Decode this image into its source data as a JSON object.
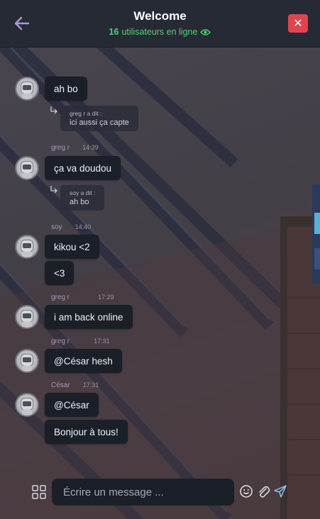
{
  "header": {
    "title": "Welcome",
    "online_count": "16",
    "online_label": "utilisateurs en ligne",
    "close_label": "✕"
  },
  "messages": [
    {
      "type": "bubble",
      "text": "ah bo"
    },
    {
      "type": "reply",
      "quoted_author": "greg r a dit :",
      "quoted_text": "ici aussi ça capte"
    },
    {
      "type": "meta",
      "author": "greg r",
      "time": "14:39"
    },
    {
      "type": "bubble",
      "text": "ça va doudou"
    },
    {
      "type": "reply",
      "quoted_author": "soy a dit :",
      "quoted_text": "ah bo"
    },
    {
      "type": "meta",
      "author": "soy",
      "time": "14:40"
    },
    {
      "type": "bubble",
      "text": "kikou <2"
    },
    {
      "type": "bubble",
      "text": "<3"
    },
    {
      "type": "meta",
      "author": "greg r",
      "time": "17:29"
    },
    {
      "type": "bubble",
      "text": "i am back online"
    },
    {
      "type": "meta",
      "author": "greg r",
      "time": "17:31"
    },
    {
      "type": "bubble",
      "text": "@César hesh"
    },
    {
      "type": "meta",
      "author": "César",
      "time": "17:31"
    },
    {
      "type": "bubble",
      "text": "@César"
    },
    {
      "type": "bubble",
      "text": "Bonjour à tous!"
    }
  ],
  "composer": {
    "placeholder": "Écrire un message ..."
  },
  "colors": {
    "header_bg": "#262a35",
    "online_green": "#4fd36a",
    "close_red": "#e0454f",
    "bubble_bg": "#1b1f28",
    "accent_purple": "#a49abf",
    "send_blue": "#8fc3f0"
  },
  "icons": {
    "back": "arrow-left-icon",
    "close": "close-icon",
    "eye": "eye-icon",
    "apps": "apps-grid-icon",
    "emoji": "emoji-icon",
    "attach": "paperclip-icon",
    "send": "send-icon",
    "reply": "reply-arrow-icon"
  }
}
